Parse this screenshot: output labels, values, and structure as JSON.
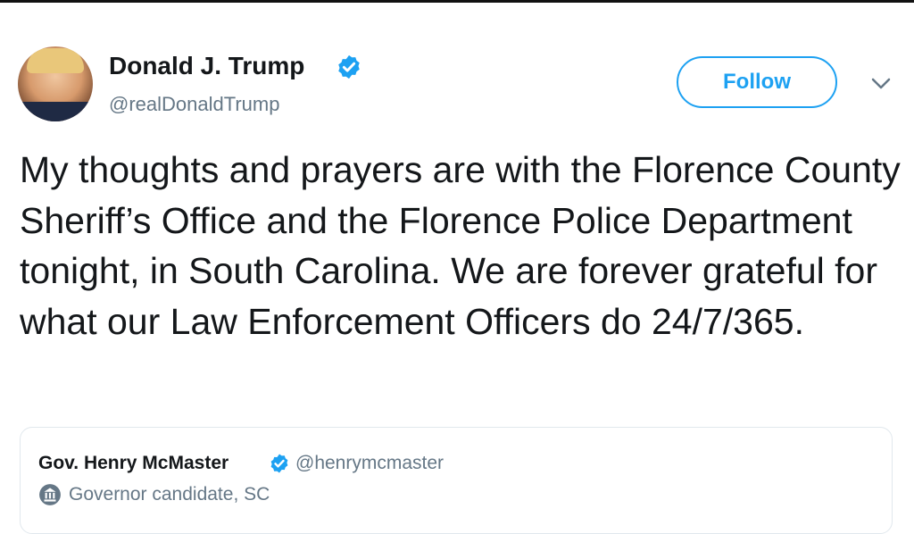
{
  "tweet": {
    "author": {
      "name": "Donald J. Trump",
      "handle": "@realDonaldTrump",
      "verified": true,
      "avatar": "profile-photo"
    },
    "follow_label": "Follow",
    "menu_icon": "chevron-down-icon",
    "text": "My thoughts and prayers are with the Florence County Sheriff’s Office and the Florence Police Department tonight, in South Carolina. We are forever grateful for what our Law Enforcement Officers do 24/7/365."
  },
  "quoted": {
    "name": "Gov. Henry McMaster",
    "handle": "@henrymcmaster",
    "verified": true,
    "label_icon": "capitol-icon",
    "label": "Governor candidate, SC"
  },
  "colors": {
    "accent": "#1da1f2",
    "text": "#14171a",
    "muted": "#657786",
    "border": "#e1e8ed"
  }
}
